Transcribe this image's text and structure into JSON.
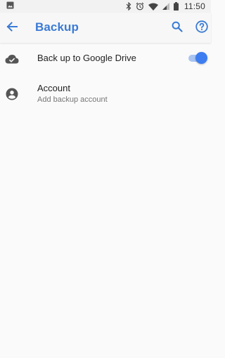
{
  "status_bar": {
    "time": "11:50",
    "icons": [
      "image-notification-icon",
      "bluetooth-icon",
      "alarm-icon",
      "wifi-icon",
      "cell-signal-icon",
      "battery-icon"
    ]
  },
  "app_bar": {
    "title": "Backup",
    "back_icon": "arrow-back-icon",
    "search_icon": "search-icon",
    "help_icon": "help-icon",
    "accent_color": "#3a7bd5"
  },
  "settings": [
    {
      "icon": "cloud-done-icon",
      "title": "Back up to Google Drive",
      "toggle_on": true
    },
    {
      "icon": "account-circle-icon",
      "title": "Account",
      "subtitle": "Add backup account"
    }
  ],
  "colors": {
    "toggle_thumb": "#3d7df0",
    "toggle_track": "#a9c4f0",
    "background": "#fafafa"
  }
}
